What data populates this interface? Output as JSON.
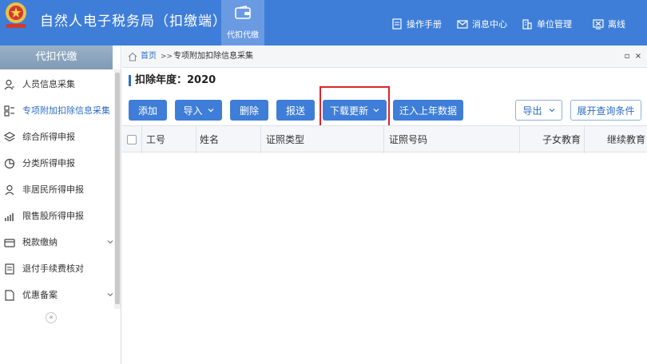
{
  "header": {
    "title": "自然人电子税务局（扣缴端）",
    "active_nav": "代扣代缴",
    "tools": [
      {
        "label": "操作手册",
        "icon": "manual-icon"
      },
      {
        "label": "消息中心",
        "icon": "mail-icon"
      },
      {
        "label": "单位管理",
        "icon": "building-icon"
      },
      {
        "label": "离线",
        "icon": "offline-icon"
      }
    ],
    "colors": {
      "bar": "#3f7ed8",
      "active": "#6a9be2"
    }
  },
  "sidebar": {
    "title": "代扣代缴",
    "items": [
      {
        "label": "人员信息采集",
        "icon": "user-icon"
      },
      {
        "label": "专项附加扣除信息采集",
        "icon": "grid-icon"
      },
      {
        "label": "综合所得申报",
        "icon": "layers-icon"
      },
      {
        "label": "分类所得申报",
        "icon": "pie-icon"
      },
      {
        "label": "非居民所得申报",
        "icon": "person-icon"
      },
      {
        "label": "限售股所得申报",
        "icon": "bar-chart-icon"
      },
      {
        "label": "税款缴纳",
        "icon": "card-icon"
      },
      {
        "label": "退付手续费核对",
        "icon": "receipt-icon"
      },
      {
        "label": "优惠备案",
        "icon": "document-icon"
      }
    ],
    "active_index": 1,
    "collapse_glyph": "«"
  },
  "breadcrumb": {
    "home": "首页",
    "separator": ">>",
    "current": "专项附加扣除信息采集",
    "restore_glyph": "▫",
    "close_glyph": "×"
  },
  "main": {
    "year_title": "扣除年度：2020",
    "toolbar": {
      "add": "添加",
      "import": "导入",
      "delete": "删除",
      "submit": "报送",
      "download_update": "下载更新",
      "migrate": "迁入上年数据",
      "export": "导出",
      "expand_query": "展开查询条件"
    },
    "table": {
      "columns": [
        "工号",
        "姓名",
        "证照类型",
        "证照号码",
        "子女教育",
        "继续教育"
      ]
    },
    "accent": "#2d6cc8",
    "highlight_color": "#d9262a"
  }
}
